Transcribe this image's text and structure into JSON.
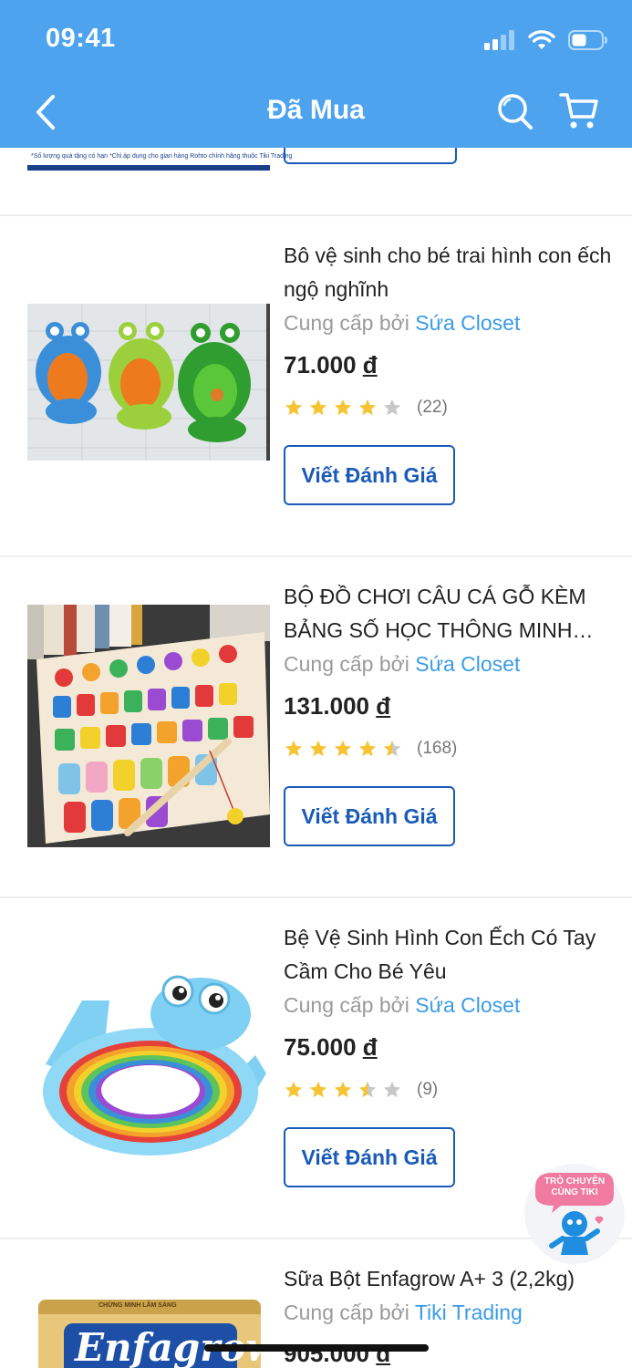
{
  "status_bar": {
    "time": "09:41"
  },
  "header": {
    "title": "Đã Mua"
  },
  "previous_item": {
    "banner_text": "*Số lượng quà tặng có hạn  *Chỉ áp dụng cho gian hàng Rohto chính hãng thuộc Tiki Trading"
  },
  "products": [
    {
      "title": "Bô vệ sinh cho bé trai hình con ếch ngộ nghĩnh",
      "seller_prefix": "Cung cấp bởi",
      "seller": "Sứa Closet",
      "price": "71.000",
      "currency": "đ",
      "rating": 4,
      "review_count": "(22)",
      "button_label": "Viết Đánh Giá",
      "image": "frog-urinals-image"
    },
    {
      "title": "BỘ ĐỒ CHƠI CÂU CÁ  GỖ KÈM BẢNG SỐ HỌC THÔNG MINH CHO BÉ",
      "seller_prefix": "Cung cấp bởi",
      "seller": "Sứa Closet",
      "price": "131.000",
      "currency": "đ",
      "rating": 4.5,
      "review_count": "(168)",
      "button_label": "Viết Đánh Giá",
      "image": "wooden-fishing-board-image"
    },
    {
      "title": "Bệ Vệ Sinh Hình Con Ếch Có Tay Cầm Cho Bé Yêu",
      "seller_prefix": "Cung cấp bởi",
      "seller": "Sứa Closet",
      "price": "75.000",
      "currency": "đ",
      "rating": 3.5,
      "review_count": "(9)",
      "button_label": "Viết Đánh Giá",
      "image": "frog-toilet-seat-image"
    },
    {
      "title": "Sữa Bột Enfagrow A+ 3 (2,2kg)",
      "seller_prefix": "Cung cấp bởi",
      "seller": "Tiki Trading",
      "price": "905.000",
      "currency": "đ",
      "image": "enfagrow-can-image",
      "image_text": "Enfagrow",
      "image_subtext": "CHỨNG MINH LÂM SÀNG"
    }
  ],
  "chat_fab": {
    "line1": "TRÒ CHUYỆN",
    "line2": "CÙNG TIKI"
  },
  "colors": {
    "header": "#4da3ee",
    "shop_link": "#3a9be8",
    "button_border": "#1a5bb8",
    "star": "#f6c433"
  }
}
